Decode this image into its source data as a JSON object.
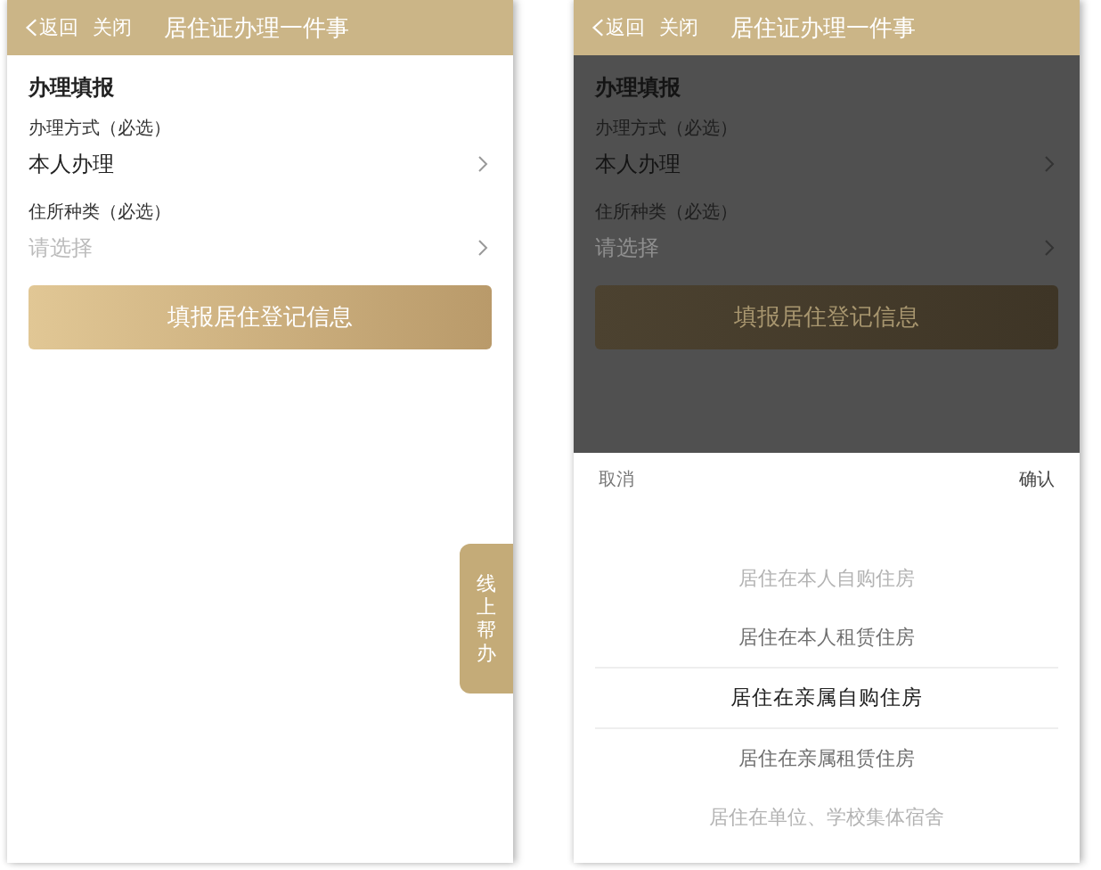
{
  "screens": [
    {
      "header": {
        "back": "返回",
        "close": "关闭",
        "title": "居住证办理一件事"
      },
      "section_title": "办理填报",
      "fields": [
        {
          "label": "办理方式（必选）",
          "value": "本人办理"
        },
        {
          "label": "住所种类（必选）",
          "placeholder": "请选择"
        }
      ],
      "submit": "填报居住登记信息",
      "help_tab": "线上帮办"
    },
    {
      "header": {
        "back": "返回",
        "close": "关闭",
        "title": "居住证办理一件事"
      },
      "section_title": "办理填报",
      "fields": [
        {
          "label": "办理方式（必选）",
          "value": "本人办理"
        },
        {
          "label": "住所种类（必选）",
          "placeholder": "请选择"
        }
      ],
      "submit": "填报居住登记信息",
      "picker": {
        "cancel": "取消",
        "confirm": "确认",
        "options": [
          {
            "label": "居住在本人自购住房",
            "selected": false
          },
          {
            "label": "居住在本人租赁住房",
            "selected": false
          },
          {
            "label": "居住在亲属自购住房",
            "selected": true
          },
          {
            "label": "居住在亲属租赁住房",
            "selected": false
          },
          {
            "label": "居住在单位、学校集体宿舍",
            "selected": false
          }
        ]
      }
    }
  ]
}
